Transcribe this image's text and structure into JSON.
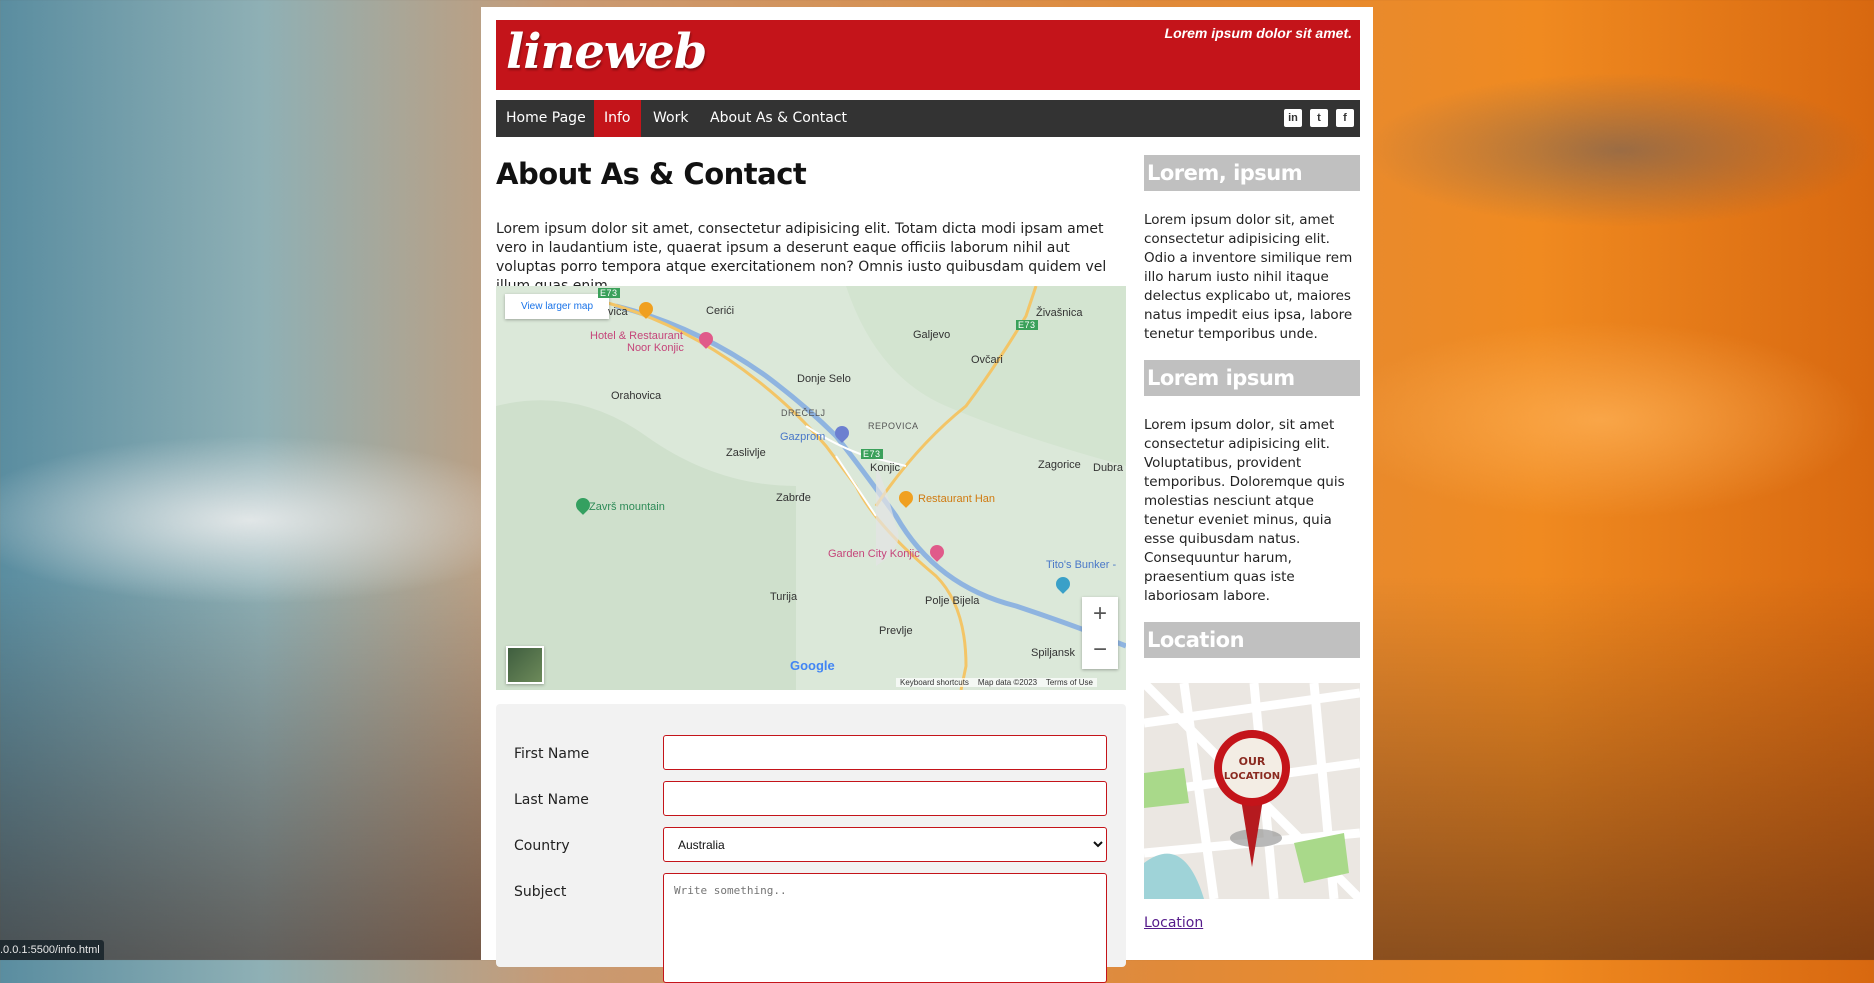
{
  "header": {
    "logo": "lineweb",
    "tagline": "Lorem ipsum dolor sit amet."
  },
  "nav": {
    "items": [
      {
        "label": "Home Page",
        "active": false
      },
      {
        "label": "Info",
        "active": true
      },
      {
        "label": "Work",
        "active": false
      },
      {
        "label": "About As & Contact",
        "active": false
      }
    ],
    "social": [
      "linkedin-icon",
      "twitter-icon",
      "facebook-icon"
    ],
    "social_glyphs": [
      "in",
      "t",
      "f"
    ]
  },
  "main": {
    "title": "About As & Contact",
    "intro": "Lorem ipsum dolor sit amet, consectetur adipisicing elit. Totam dicta modi ipsam amet vero in laudantium iste, quaerat ipsum a deserunt eaque officiis laborum nihil aut voluptas porro tempora atque exercitationem non? Omnis iusto quibusdam quidem vel illum quas enim."
  },
  "map": {
    "view_larger": "View larger map",
    "zoom_in": "+",
    "zoom_out": "−",
    "google": "Google",
    "footer": {
      "shortcuts": "Keyboard shortcuts",
      "data": "Map data ©2023",
      "terms": "Terms of Use"
    },
    "labels": {
      "cerici": "Cerići",
      "zivasnica": "Živašnica",
      "galjevo": "Galjevo",
      "ovcari": "Ovčari",
      "hotel": "Hotel & Restaurant Noor Konjic",
      "hotel_1": "Hotel & Restaurant",
      "hotel_2": "Noor Konjic",
      "donje_selo": "Donje Selo",
      "orahovica": "Orahovica",
      "drecelj": "DREČELJ",
      "repovica": "REPOVICA",
      "gazprom": "Gazprom",
      "zaslivlje": "Zaslivlje",
      "konjic": "Konjic",
      "zagorice": "Zagorice",
      "dubra": "Dubra",
      "zavrs": "Završ mountain",
      "zabrde": "Zabrđe",
      "restaurant_han": "Restaurant Han",
      "garden_city": "Garden City Konjic",
      "titos_bunker": "Tito's Bunker -",
      "turija": "Turija",
      "polje_bijela": "Polje Bijela",
      "prevlje": "Prevlje",
      "spiljansk": "Spiljansk",
      "vica": "vica",
      "e73_a": "E73",
      "e73_b": "E73",
      "e73_c": "E73"
    }
  },
  "form": {
    "first_name_label": "First Name",
    "last_name_label": "Last Name",
    "country_label": "Country",
    "country_value": "Australia",
    "subject_label": "Subject",
    "subject_placeholder": "Write something.."
  },
  "sidebar": {
    "section1_title": "Lorem, ipsum",
    "section1_text": "Lorem ipsum dolor sit, amet consectetur adipisicing elit. Odio a inventore similique rem illo harum iusto nihil itaque delectus explicabo ut, maiores natus impedit eius ipsa, labore tenetur temporibus unde.",
    "section2_title": "Lorem ipsum",
    "section2_text": "Lorem ipsum dolor, sit amet consectetur adipisicing elit. Voluptatibus, provident temporibus. Doloremque quis molestias nesciunt atque tenetur eveniet minus, quia esse quibusdam natus. Consequuntur harum, praesentium quas iste laboriosam labore.",
    "section3_title": "Location",
    "pin_text_1": "OUR",
    "pin_text_2": "LOCATION",
    "location_link": "Location"
  },
  "status_bar": ".0.0.1:5500/info.html",
  "colors": {
    "brand_red": "#c4141a",
    "nav_dark": "#333333",
    "sidebar_head": "#c0c0c0"
  }
}
